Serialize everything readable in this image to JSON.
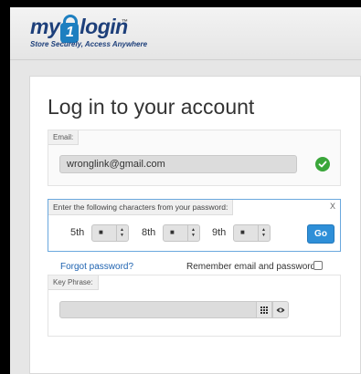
{
  "logo": {
    "text_before": "my",
    "digit": "1",
    "text_after": "login",
    "tm": "™",
    "tagline": "Store Securely, Access Anywhere"
  },
  "page_title": "Log in to your account",
  "email": {
    "label": "Email:",
    "value": "wronglink@gmail.com",
    "status_icon": "check-circle-icon"
  },
  "password": {
    "instruction": "Enter the following characters from your password:",
    "close_label": "X",
    "positions": [
      {
        "label": "5th",
        "selected": "■"
      },
      {
        "label": "8th",
        "selected": "■"
      },
      {
        "label": "9th",
        "selected": "■"
      }
    ],
    "go_label": "Go"
  },
  "forgot_label": "Forgot password?",
  "remember_label": "Remember email and password",
  "key_phrase": {
    "label": "Key Phrase:",
    "value": ""
  },
  "colors": {
    "brand": "#1d3f7a",
    "accent": "#2e8fd8",
    "success": "#3aa63a"
  }
}
